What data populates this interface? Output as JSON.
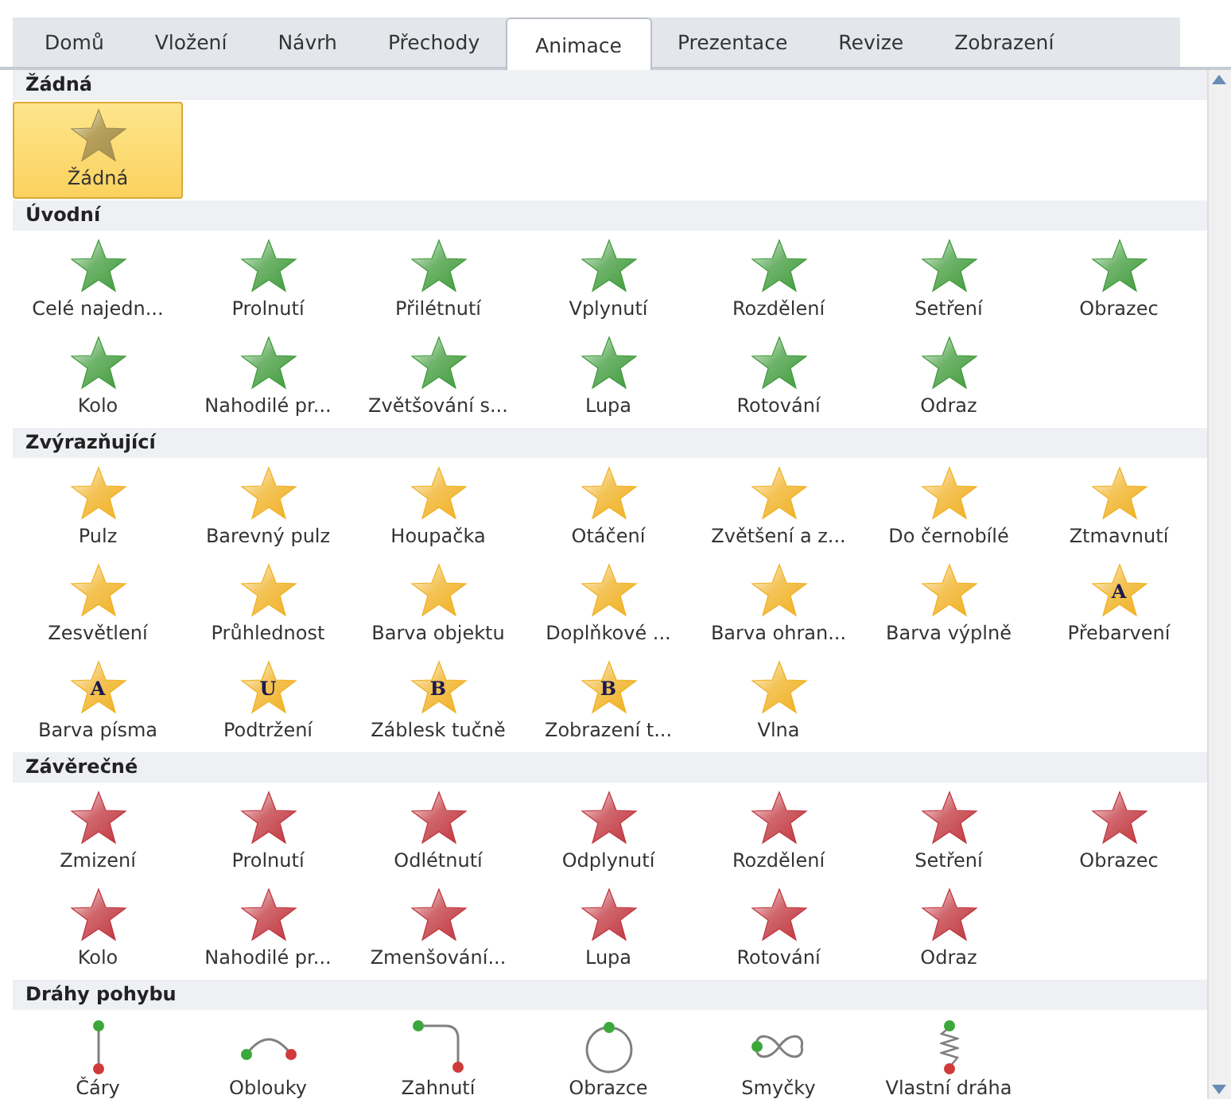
{
  "tabs": [
    {
      "label": "Domů",
      "selected": false
    },
    {
      "label": "Vložení",
      "selected": false
    },
    {
      "label": "Návrh",
      "selected": false
    },
    {
      "label": "Přechody",
      "selected": false
    },
    {
      "label": "Animace",
      "selected": true
    },
    {
      "label": "Prezentace",
      "selected": false
    },
    {
      "label": "Revize",
      "selected": false
    },
    {
      "label": "Zobrazení",
      "selected": false
    }
  ],
  "sections": [
    {
      "title": "Žádná",
      "kind": "none",
      "items": [
        {
          "label": "Žádná",
          "kind": "star",
          "selected": true
        }
      ]
    },
    {
      "title": "Úvodní",
      "kind": "entrance",
      "items": [
        {
          "label": "Celé najedn...",
          "kind": "star",
          "selected": false
        },
        {
          "label": "Prolnutí",
          "kind": "star",
          "selected": false
        },
        {
          "label": "Přilétnutí",
          "kind": "star",
          "selected": false
        },
        {
          "label": "Vplynutí",
          "kind": "star",
          "selected": false
        },
        {
          "label": "Rozdělení",
          "kind": "star",
          "selected": false
        },
        {
          "label": "Setření",
          "kind": "star",
          "selected": false
        },
        {
          "label": "Obrazec",
          "kind": "star",
          "selected": false
        },
        {
          "label": "Kolo",
          "kind": "star",
          "selected": false
        },
        {
          "label": "Nahodilé pr...",
          "kind": "star",
          "selected": false
        },
        {
          "label": "Zvětšování s...",
          "kind": "star",
          "selected": false
        },
        {
          "label": "Lupa",
          "kind": "star",
          "selected": false
        },
        {
          "label": "Rotování",
          "kind": "star",
          "selected": false
        },
        {
          "label": "Odraz",
          "kind": "star",
          "selected": false
        }
      ]
    },
    {
      "title": "Zvýrazňující",
      "kind": "emphasis",
      "items": [
        {
          "label": "Pulz",
          "kind": "star",
          "selected": false
        },
        {
          "label": "Barevný pulz",
          "kind": "star",
          "selected": false
        },
        {
          "label": "Houpačka",
          "kind": "star",
          "selected": false
        },
        {
          "label": "Otáčení",
          "kind": "star",
          "selected": false
        },
        {
          "label": "Zvětšení a z...",
          "kind": "star",
          "selected": false
        },
        {
          "label": "Do černobílé",
          "kind": "star",
          "selected": false
        },
        {
          "label": "Ztmavnutí",
          "kind": "star",
          "selected": false
        },
        {
          "label": "Zesvětlení",
          "kind": "star",
          "selected": false
        },
        {
          "label": "Průhlednost",
          "kind": "star",
          "selected": false
        },
        {
          "label": "Barva objektu",
          "kind": "star",
          "selected": false
        },
        {
          "label": "Doplňkové ...",
          "kind": "star",
          "selected": false
        },
        {
          "label": "Barva ohran...",
          "kind": "star",
          "selected": false
        },
        {
          "label": "Barva výplně",
          "kind": "star",
          "selected": false
        },
        {
          "label": "Přebarvení",
          "kind": "star",
          "glyph": "A",
          "selected": false
        },
        {
          "label": "Barva písma",
          "kind": "star",
          "glyph": "A",
          "selected": false
        },
        {
          "label": "Podtržení",
          "kind": "star",
          "glyph": "U",
          "selected": false
        },
        {
          "label": "Záblesk tučně",
          "kind": "star",
          "glyph": "B",
          "selected": false
        },
        {
          "label": "Zobrazení t...",
          "kind": "star",
          "glyph": "B",
          "selected": false
        },
        {
          "label": "Vlna",
          "kind": "star",
          "selected": false
        }
      ]
    },
    {
      "title": "Závěrečné",
      "kind": "exit",
      "items": [
        {
          "label": "Zmizení",
          "kind": "star",
          "selected": false
        },
        {
          "label": "Prolnutí",
          "kind": "star",
          "selected": false
        },
        {
          "label": "Odlétnutí",
          "kind": "star",
          "selected": false
        },
        {
          "label": "Odplynutí",
          "kind": "star",
          "selected": false
        },
        {
          "label": "Rozdělení",
          "kind": "star",
          "selected": false
        },
        {
          "label": "Setření",
          "kind": "star",
          "selected": false
        },
        {
          "label": "Obrazec",
          "kind": "star",
          "selected": false
        },
        {
          "label": "Kolo",
          "kind": "star",
          "selected": false
        },
        {
          "label": "Nahodilé pr...",
          "kind": "star",
          "selected": false
        },
        {
          "label": "Zmenšování...",
          "kind": "star",
          "selected": false
        },
        {
          "label": "Lupa",
          "kind": "star",
          "selected": false
        },
        {
          "label": "Rotování",
          "kind": "star",
          "selected": false
        },
        {
          "label": "Odraz",
          "kind": "star",
          "selected": false
        }
      ]
    },
    {
      "title": "Dráhy pohybu",
      "kind": "path",
      "items": [
        {
          "label": "Čáry",
          "kind": "line",
          "selected": false
        },
        {
          "label": "Oblouky",
          "kind": "arc",
          "selected": false
        },
        {
          "label": "Zahnutí",
          "kind": "turn",
          "selected": false
        },
        {
          "label": "Obrazce",
          "kind": "circle",
          "selected": false
        },
        {
          "label": "Smyčky",
          "kind": "loop",
          "selected": false
        },
        {
          "label": "Vlastní dráha",
          "kind": "spring",
          "selected": false
        }
      ]
    }
  ]
}
